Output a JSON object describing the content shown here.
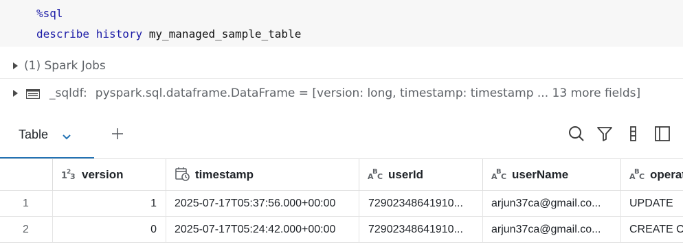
{
  "code": {
    "magic": "%sql",
    "line2_keyword": "describe history",
    "line2_table": "my_managed_sample_table"
  },
  "spark_jobs": {
    "label": "(1) Spark Jobs"
  },
  "dataframe": {
    "name": "_sqldf:",
    "schema": "pyspark.sql.dataframe.DataFrame = [version: long, timestamp: timestamp ... 13 more fields]"
  },
  "tabs": {
    "active_label": "Table",
    "add_label": "+"
  },
  "toolbar": {
    "icons": [
      "search-icon",
      "filter-icon",
      "column-density-icon",
      "sidebar-panel-icon"
    ]
  },
  "table": {
    "columns": [
      {
        "name": "version",
        "type_icon": "1²₃"
      },
      {
        "name": "timestamp",
        "type_icon": "calendar-clock"
      },
      {
        "name": "userId",
        "type_icon": "ABC"
      },
      {
        "name": "userName",
        "type_icon": "ABC"
      },
      {
        "name": "operat",
        "type_icon": "ABC"
      }
    ],
    "rows": [
      {
        "index": "1",
        "version": "1",
        "timestamp": "2025-07-17T05:37:56.000+00:00",
        "userId": "72902348641910...",
        "userName": "arjun37ca@gmail.co...",
        "operation": "UPDATE"
      },
      {
        "index": "2",
        "version": "0",
        "timestamp": "2025-07-17T05:24:42.000+00:00",
        "userId": "72902348641910...",
        "userName": "arjun37ca@gmail.co...",
        "operation": "CREATE O"
      }
    ]
  },
  "colors": {
    "accent": "#2272b4",
    "keyword": "#1a1aa6",
    "muted_text": "#5f6368"
  }
}
